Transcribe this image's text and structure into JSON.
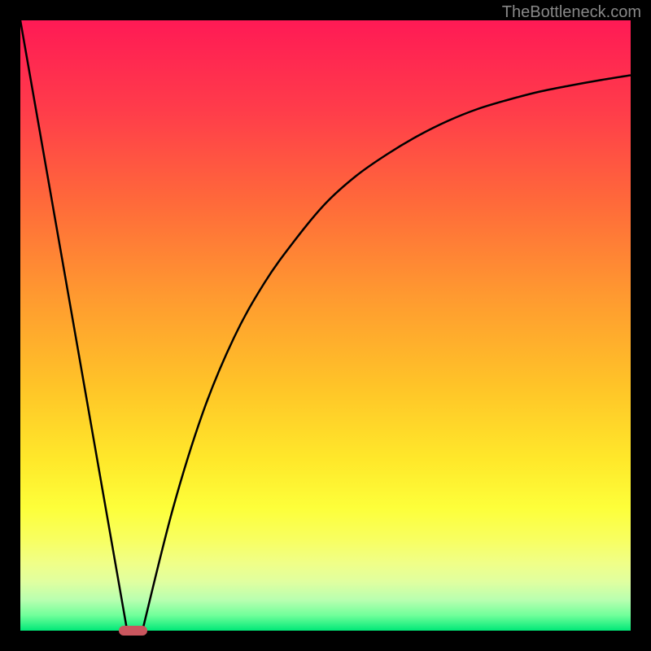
{
  "watermark": "TheBottleneck.com",
  "chart_data": {
    "type": "line",
    "title": "",
    "xlabel": "",
    "ylabel": "",
    "xlim": [
      0,
      100
    ],
    "ylim": [
      0,
      100
    ],
    "series": [
      {
        "name": "left-line",
        "x": [
          0,
          17.5
        ],
        "y": [
          100,
          0
        ]
      },
      {
        "name": "right-curve",
        "x": [
          20,
          25,
          30,
          35,
          40,
          45,
          50,
          55,
          60,
          65,
          70,
          75,
          80,
          85,
          90,
          95,
          100
        ],
        "y": [
          0,
          20,
          36,
          48,
          57,
          64,
          70,
          74.5,
          78,
          81,
          83.5,
          85.5,
          87,
          88.3,
          89.3,
          90.2,
          91
        ]
      }
    ],
    "marker": {
      "x": 18.5,
      "y": 0
    },
    "gradient_stops": [
      {
        "offset": 0,
        "color": "#ff1a55"
      },
      {
        "offset": 15,
        "color": "#ff3d4a"
      },
      {
        "offset": 30,
        "color": "#ff6a3a"
      },
      {
        "offset": 45,
        "color": "#ff9930"
      },
      {
        "offset": 60,
        "color": "#ffc428"
      },
      {
        "offset": 72,
        "color": "#ffe82a"
      },
      {
        "offset": 80,
        "color": "#fdff3a"
      },
      {
        "offset": 85,
        "color": "#f8ff60"
      },
      {
        "offset": 89,
        "color": "#f0ff88"
      },
      {
        "offset": 92,
        "color": "#e0ffa0"
      },
      {
        "offset": 95,
        "color": "#b8ffb0"
      },
      {
        "offset": 97.5,
        "color": "#70ff9a"
      },
      {
        "offset": 100,
        "color": "#00e878"
      }
    ]
  }
}
